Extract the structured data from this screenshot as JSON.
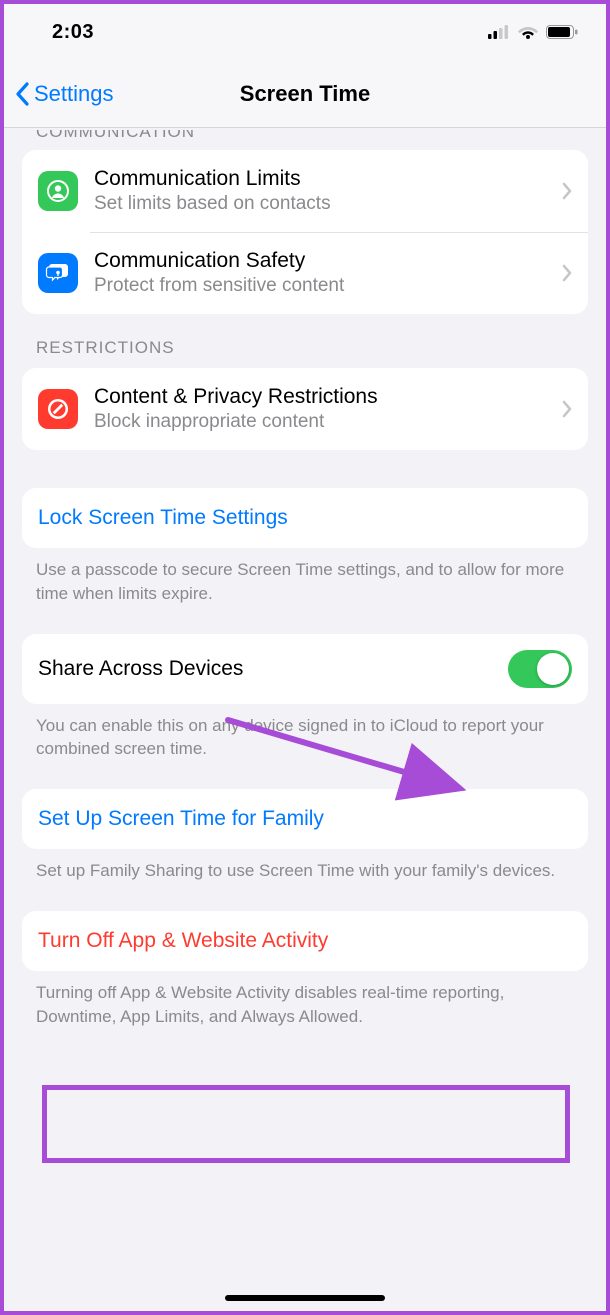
{
  "status": {
    "time": "2:03"
  },
  "nav": {
    "back": "Settings",
    "title": "Screen Time"
  },
  "communication": {
    "header_truncated": "COMMUNICATION",
    "limits": {
      "title": "Communication Limits",
      "sub": "Set limits based on contacts"
    },
    "safety": {
      "title": "Communication Safety",
      "sub": "Protect from sensitive content"
    }
  },
  "restrictions": {
    "header": "RESTRICTIONS",
    "content": {
      "title": "Content & Privacy Restrictions",
      "sub": "Block inappropriate content"
    }
  },
  "lock": {
    "title": "Lock Screen Time Settings",
    "footer": "Use a passcode to secure Screen Time settings, and to allow for more time when limits expire."
  },
  "share": {
    "title": "Share Across Devices",
    "enabled": true,
    "footer": "You can enable this on any device signed in to iCloud to report your combined screen time."
  },
  "family": {
    "title": "Set Up Screen Time for Family",
    "footer": "Set up Family Sharing to use Screen Time with your family's devices."
  },
  "turnoff": {
    "title": "Turn Off App & Website Activity",
    "footer": "Turning off App & Website Activity disables real-time reporting, Downtime, App Limits, and Always Allowed."
  }
}
